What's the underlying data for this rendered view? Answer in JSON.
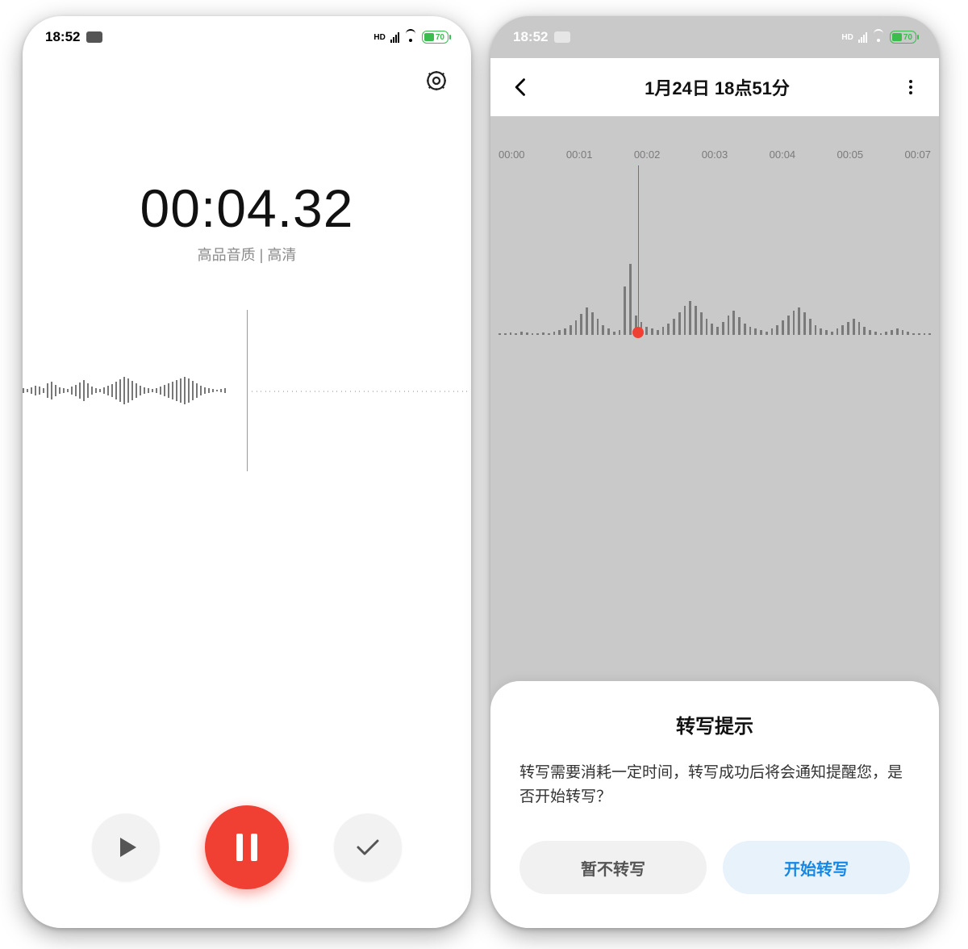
{
  "status": {
    "time": "18:52",
    "battery": "70"
  },
  "left": {
    "timer": "00:04.32",
    "quality": "高品音质 | 高清",
    "waveform_heights": [
      6,
      4,
      8,
      12,
      10,
      6,
      18,
      22,
      14,
      8,
      6,
      4,
      10,
      14,
      20,
      26,
      18,
      10,
      6,
      4,
      8,
      12,
      16,
      22,
      28,
      34,
      30,
      24,
      18,
      12,
      8,
      6,
      4,
      6,
      10,
      14,
      18,
      22,
      26,
      30,
      34,
      30,
      24,
      18,
      12,
      8,
      6,
      4,
      2,
      4,
      6
    ]
  },
  "right": {
    "title": "1月24日 18点51分",
    "timeline": [
      "00:00",
      "00:01",
      "00:02",
      "00:03",
      "00:04",
      "00:05",
      "00:07"
    ],
    "waveform_heights": [
      2,
      2,
      3,
      2,
      4,
      3,
      2,
      2,
      3,
      2,
      4,
      6,
      8,
      12,
      18,
      26,
      34,
      28,
      20,
      12,
      8,
      4,
      6,
      60,
      88,
      24,
      16,
      10,
      8,
      6,
      10,
      14,
      20,
      28,
      36,
      42,
      36,
      28,
      20,
      14,
      10,
      16,
      24,
      30,
      22,
      14,
      10,
      8,
      6,
      4,
      8,
      12,
      18,
      24,
      30,
      34,
      28,
      20,
      12,
      8,
      6,
      4,
      8,
      12,
      16,
      20,
      16,
      10,
      6,
      4,
      2,
      4,
      6,
      8,
      6,
      4,
      2,
      2,
      2,
      2
    ]
  },
  "sheet": {
    "heading": "转写提示",
    "body": "转写需要消耗一定时间，转写成功后将会通知提醒您，是否开始转写？",
    "cancel": "暂不转写",
    "confirm": "开始转写"
  }
}
